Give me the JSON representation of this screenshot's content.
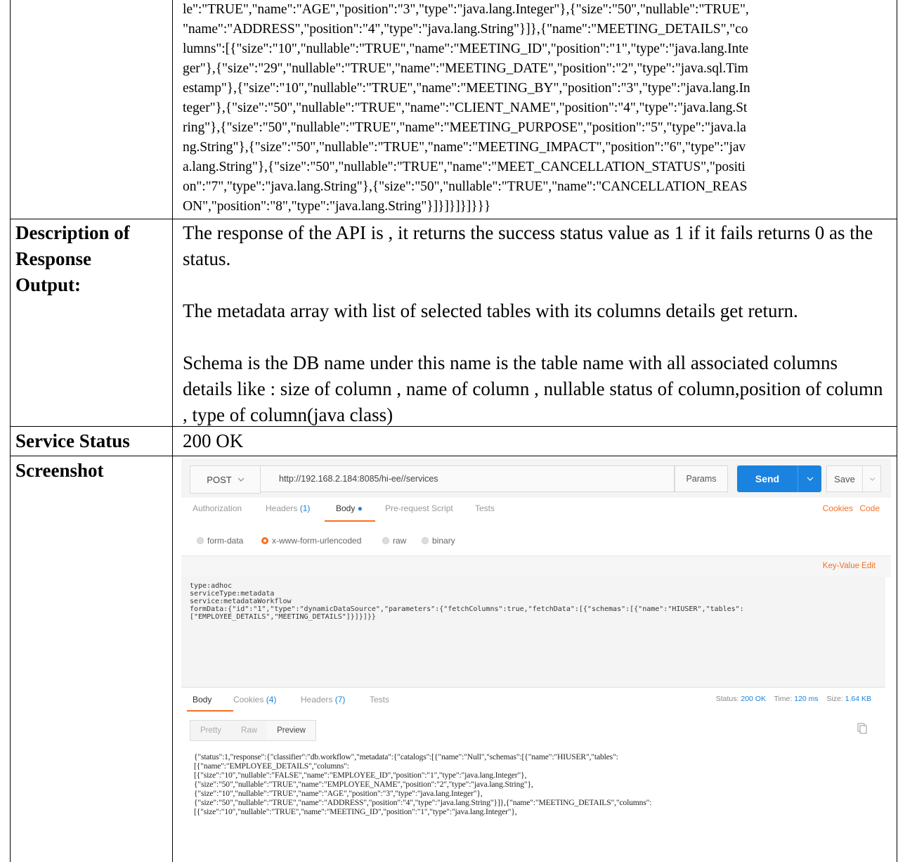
{
  "top_json": {
    "lines": [
      "le\":\"TRUE\",\"name\":\"AGE\",\"position\":\"3\",\"type\":\"java.lang.Integer\"},{\"size\":\"50\",\"nullable\":\"TRUE\",",
      "\"name\":\"ADDRESS\",\"position\":\"4\",\"type\":\"java.lang.String\"}]},{\"name\":\"MEETING_DETAILS\",\"co",
      "lumns\":[{\"size\":\"10\",\"nullable\":\"TRUE\",\"name\":\"MEETING_ID\",\"position\":\"1\",\"type\":\"java.lang.Inte",
      "ger\"},{\"size\":\"29\",\"nullable\":\"TRUE\",\"name\":\"MEETING_DATE\",\"position\":\"2\",\"type\":\"java.sql.Tim",
      "estamp\"},{\"size\":\"10\",\"nullable\":\"TRUE\",\"name\":\"MEETING_BY\",\"position\":\"3\",\"type\":\"java.lang.In",
      "teger\"},{\"size\":\"50\",\"nullable\":\"TRUE\",\"name\":\"CLIENT_NAME\",\"position\":\"4\",\"type\":\"java.lang.St",
      "ring\"},{\"size\":\"50\",\"nullable\":\"TRUE\",\"name\":\"MEETING_PURPOSE\",\"position\":\"5\",\"type\":\"java.la",
      "ng.String\"},{\"size\":\"50\",\"nullable\":\"TRUE\",\"name\":\"MEETING_IMPACT\",\"position\":\"6\",\"type\":\"jav",
      "a.lang.String\"},{\"size\":\"50\",\"nullable\":\"TRUE\",\"name\":\"MEET_CANCELLATION_STATUS\",\"positi",
      "on\":\"7\",\"type\":\"java.lang.String\"},{\"size\":\"50\",\"nullable\":\"TRUE\",\"name\":\"CANCELLATION_REAS",
      "ON\",\"position\":\"8\",\"type\":\"java.lang.String\"}]}]}]}]}}}"
    ]
  },
  "rows": {
    "description": {
      "label_lines": [
        "Description of",
        "Response",
        "Output:"
      ],
      "para1": "The response of the API is , it returns the success status value as 1 if it fails returns 0 as the status.",
      "para2": "The metadata array with list of selected tables with its columns details get return.",
      "para3": "Schema is the DB name under this name is the table name with all associated columns details like : size of column , name of column , nullable status of column,position of column , type of column(java class)"
    },
    "service_status": {
      "label": "Service Status",
      "value": "200 OK"
    },
    "screenshot": {
      "label": "Screenshot"
    }
  },
  "postman": {
    "method": "POST",
    "url": "http://192.168.2.184:8085/hi-ee//services",
    "params_label": "Params",
    "send_label": "Send",
    "save_label": "Save",
    "tabs": {
      "authorization": "Authorization",
      "headers": "Headers",
      "headers_count": "(1)",
      "body": "Body",
      "prerequest": "Pre-request Script",
      "tests": "Tests",
      "cookies": "Cookies",
      "code": "Code"
    },
    "body_types": {
      "form_data": "form-data",
      "urlencoded": "x-www-form-urlencoded",
      "raw": "raw",
      "binary": "binary"
    },
    "key_value_edit": "Key-Value Edit",
    "request_body": "type:adhoc\nserviceType:metadata\nservice:metadataWorkflow\nformData:{\"id\":\"1\",\"type\":\"dynamicDataSource\",\"parameters\":{\"fetchColumns\":true,\"fetchData\":[{\"schemas\":[{\"name\":\"HIUSER\",\"tables\":\n[\"EMPLOYEE_DETAILS\",\"MEETING_DETAILS\"]}]}]}}",
    "response_tabs": {
      "body": "Body",
      "cookies": "Cookies",
      "cookies_count": "(4)",
      "headers": "Headers",
      "headers_count": "(7)",
      "tests": "Tests"
    },
    "status_label": "Status:",
    "status_value": "200 OK",
    "time_label": "Time:",
    "time_value": "120 ms",
    "size_label": "Size:",
    "size_value": "1.64 KB",
    "format_buttons": {
      "pretty": "Pretty",
      "raw": "Raw",
      "preview": "Preview"
    },
    "response_body": "{\"status\":1,\"response\":{\"classifier\":\"db.workflow\",\"metadata\":{\"catalogs\":[{\"name\":\"Null\",\"schemas\":[{\"name\":\"HIUSER\",\"tables\":\n[{\"name\":\"EMPLOYEE_DETAILS\",\"columns\":\n[{\"size\":\"10\",\"nullable\":\"FALSE\",\"name\":\"EMPLOYEE_ID\",\"position\":\"1\",\"type\":\"java.lang.Integer\"},\n{\"size\":\"50\",\"nullable\":\"TRUE\",\"name\":\"EMPLOYEE_NAME\",\"position\":\"2\",\"type\":\"java.lang.String\"},\n{\"size\":\"10\",\"nullable\":\"TRUE\",\"name\":\"AGE\",\"position\":\"3\",\"type\":\"java.lang.Integer\"},\n{\"size\":\"50\",\"nullable\":\"TRUE\",\"name\":\"ADDRESS\",\"position\":\"4\",\"type\":\"java.lang.String\"}]},{\"name\":\"MEETING_DETAILS\",\"columns\":\n[{\"size\":\"10\",\"nullable\":\"TRUE\",\"name\":\"MEETING_ID\",\"position\":\"1\",\"type\":\"java.lang.Integer\"},",
    "colors": {
      "accent_orange": "#f47023",
      "send_blue": "#1a83e0"
    }
  }
}
